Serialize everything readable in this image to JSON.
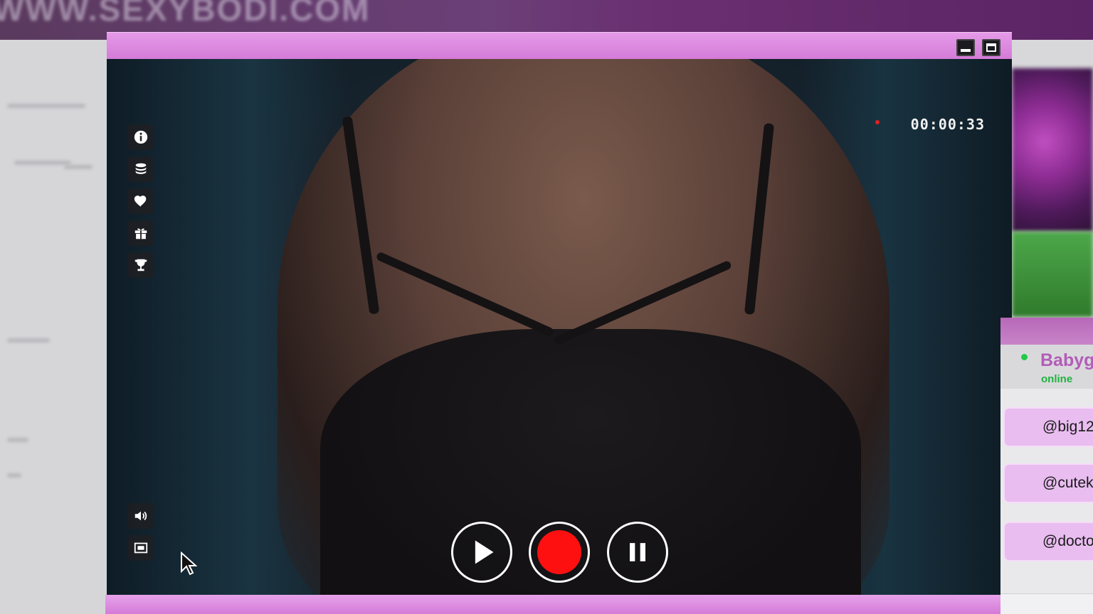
{
  "background_site": {
    "logo": "WWW.SEXYBODI.COM"
  },
  "player": {
    "timer": "00:00:33",
    "side_tools": [
      {
        "icon": "info-icon"
      },
      {
        "icon": "coins-icon"
      },
      {
        "icon": "heart-icon"
      },
      {
        "icon": "gift-icon"
      },
      {
        "icon": "trophy-icon"
      }
    ],
    "bottom_tools": [
      {
        "icon": "volume-icon"
      },
      {
        "icon": "fullscreen-icon"
      }
    ],
    "controls": {
      "play": "play-icon",
      "record": "record-icon",
      "pause": "pause-icon"
    },
    "colors": {
      "frame": "#d47bd8",
      "record": "#ff1010"
    }
  },
  "chat": {
    "user_name": "Babyg",
    "user_status": "online",
    "items": [
      {
        "handle": "@big12"
      },
      {
        "handle": "@cutek"
      },
      {
        "handle": "@docto"
      }
    ],
    "colors": {
      "name": "#b35cb8",
      "status": "#1fb23f",
      "item_bg": "#e9bdf0"
    }
  }
}
